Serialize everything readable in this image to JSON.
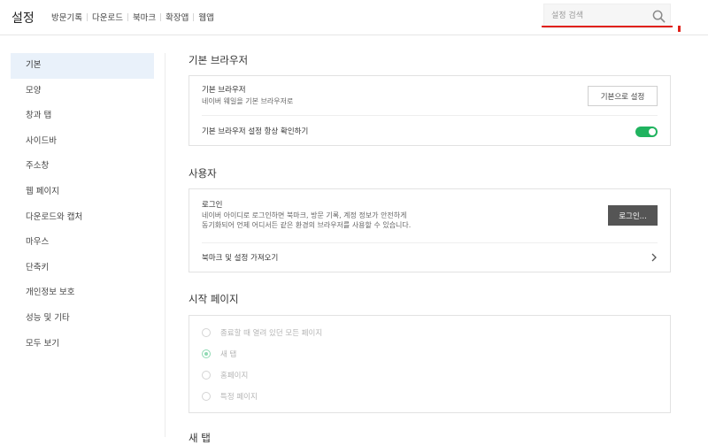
{
  "header": {
    "title": "설정",
    "links": [
      "방문기록",
      "다운로드",
      "북마크",
      "확장앱",
      "웹앱"
    ],
    "search": {
      "placeholder": "설정 검색",
      "icon": "search-icon"
    }
  },
  "sidebar": {
    "items": [
      {
        "label": "기본",
        "active": true
      },
      {
        "label": "모양"
      },
      {
        "label": "창과 탭"
      },
      {
        "label": "사이드바"
      },
      {
        "label": "주소창"
      },
      {
        "label": "웹 페이지"
      },
      {
        "label": "다운로드와 캡처"
      },
      {
        "label": "마우스"
      },
      {
        "label": "단축키"
      },
      {
        "label": "개인정보 보호"
      },
      {
        "label": "성능 및 기타"
      },
      {
        "label": "모두 보기"
      }
    ]
  },
  "sections": {
    "default_browser": {
      "title": "기본 브라우저",
      "row1": {
        "title": "기본 브라우저",
        "subtitle": "네이버 웨일을 기본 브라우저로",
        "button": "기본으로 설정"
      },
      "row2": {
        "title": "기본 브라우저 설정 항상 확인하기",
        "toggle_on": true
      }
    },
    "user": {
      "title": "사용자",
      "login": {
        "title": "로그인",
        "line1": "네이버 아이디로 로그인하면 북마크, 방문 기록, 계정 정보가 안전하게",
        "line2": "동기화되어 언제 어디서든 같은 환경의 브라우저를 사용할 수 있습니다.",
        "button": "로그인..."
      },
      "import": {
        "label": "북마크 및 설정 가져오기",
        "icon": "chevron-right-icon"
      }
    },
    "start_page": {
      "title": "시작 페이지",
      "options": [
        {
          "label": "종료할 때 열려 있던 모든 페이지",
          "checked": false
        },
        {
          "label": "새 탭",
          "checked": true
        },
        {
          "label": "홈페이지",
          "checked": false
        },
        {
          "label": "특정 페이지",
          "checked": false
        }
      ]
    },
    "next": {
      "title": "새 탭"
    }
  },
  "colors": {
    "accent": "#20b35f",
    "highlight": "#e0201a",
    "active_bg": "#e9f1fa"
  }
}
